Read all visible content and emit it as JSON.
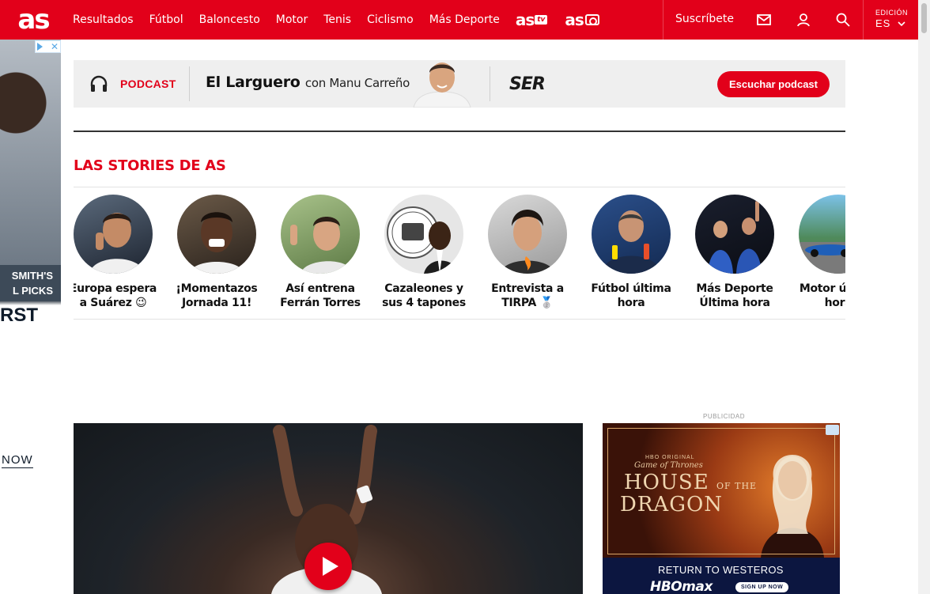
{
  "header": {
    "logo": "as",
    "nav": [
      "Resultados",
      "Fútbol",
      "Baloncesto",
      "Motor",
      "Tenis",
      "Ciclismo",
      "Más Deporte"
    ],
    "brand_tv": "as",
    "brand_tv_badge": "tv",
    "brand_foto": "as",
    "subscribe": "Suscríbete",
    "edition_label": "EDICIÓN",
    "edition_value": "ES",
    "icons": [
      "mail-icon",
      "user-icon",
      "search-icon",
      "chevron-down-icon"
    ],
    "accent_color": "#e2001a"
  },
  "left_ad": {
    "line1": "SMITH'S",
    "line2": "L PICKS",
    "big": "RST",
    "cta": "NOW"
  },
  "podcast": {
    "label": "PODCAST",
    "title": "El Larguero",
    "host": "con Manu Carreño",
    "network": "SER",
    "button": "Escuchar podcast"
  },
  "stories": {
    "heading": "LAS STORIES DE AS",
    "items": [
      {
        "line1": "Europa espera",
        "line2": "a Suárez 😉"
      },
      {
        "line1": "¡Momentazos",
        "line2": "Jornada 11!"
      },
      {
        "line1": "Así entrena",
        "line2": "Ferrán Torres"
      },
      {
        "line1": "Cazaleones y",
        "line2": "sus 4 tapones"
      },
      {
        "line1": "Entrevista a",
        "line2": "TIRPA 🥈"
      },
      {
        "line1": "Fútbol última",
        "line2": "hora"
      },
      {
        "line1": "Más Deporte",
        "line2": "Última hora"
      },
      {
        "line1": "Motor última",
        "line2": "hora"
      }
    ]
  },
  "ads": {
    "publicidad": "PUBLICIDAD",
    "hbo_original": "HBO ORIGINAL",
    "got": "Game of Thrones",
    "house": "HOUSE",
    "of_the": "OF THE",
    "dragon": "DRAGON",
    "tagline": "RETURN TO WESTEROS",
    "brand": "HBOmax",
    "signup": "SIGN UP NOW"
  }
}
